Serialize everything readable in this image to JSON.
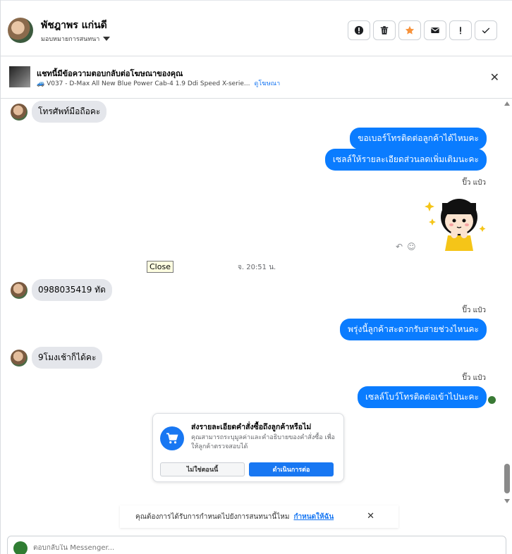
{
  "header": {
    "contact_name": "พัชฎาพร แก่นดี",
    "assign_label": "มอบหมายการสนทนา",
    "actions": [
      {
        "icon": "alert-circle-icon",
        "name": "mark-spam-button"
      },
      {
        "icon": "trash-icon",
        "name": "delete-button"
      },
      {
        "icon": "star-icon",
        "name": "star-button"
      },
      {
        "icon": "envelope-icon",
        "name": "mark-unread-button"
      },
      {
        "icon": "exclamation-icon",
        "name": "follow-up-button"
      },
      {
        "icon": "check-icon",
        "name": "mark-done-button"
      }
    ],
    "star_color": "#f7923b"
  },
  "ad_bar": {
    "title": "แชทนี้มีข้อความตอบกลับต่อโฆษณาของคุณ",
    "subtitle": "🚙 V037 - D-Max All New Blue Power Cab-4 1.9 Ddi Speed X-serie...",
    "link": "ดูโฆษณา",
    "close": "✕"
  },
  "messages": {
    "in1": "โทรศัพท์มือถือคะ",
    "out1": "ขอเบอร์โทรติดต่อลูกค้าได้ไหมคะ",
    "out2": "เซลล์ให้รายละเอียดส่วนลดเพิ่มเติมนะคะ",
    "sender1": "ปิ๊ว แป๋ว",
    "timestamp": "จ. 20:51 น.",
    "tooltip": "Close",
    "in2": "0988035419 ทัด",
    "sender2": "ปิ๊ว แป๋ว",
    "out3": "พรุ่งนี้ลูกค้าสะดวกรับสายช่วงไหนคะ",
    "in3": "9โมงเช้าก็ได้คะ",
    "sender3": "ปิ๊ว แป๋ว",
    "out4": "เซลล์โบว์โทรติดต่อเข้าไปนะคะ"
  },
  "order_card": {
    "title": "ส่งรายละเอียดคำสั่งซื้อถึงลูกค้าหรือไม่",
    "description": "คุณสามารถระบุมูลค่าและคำอธิบายของคำสั่งซื้อ เพื่อให้ลูกค้าตรวจสอบได้",
    "no_label": "ไม่ใช่ตอนนี้",
    "yes_label": "ดำเนินการต่อ"
  },
  "notice": {
    "text": "คุณต้องการได้รับการกำหนดไปยังการสนทนานี้ไหม",
    "link": "กำหนดให้ฉัน",
    "close": "✕"
  },
  "composer": {
    "placeholder": "ตอบกลับใน Messenger..."
  },
  "colors": {
    "outgoing_bubble": "#0a7cff",
    "incoming_bubble": "#e4e6eb",
    "primary": "#1877f2"
  }
}
